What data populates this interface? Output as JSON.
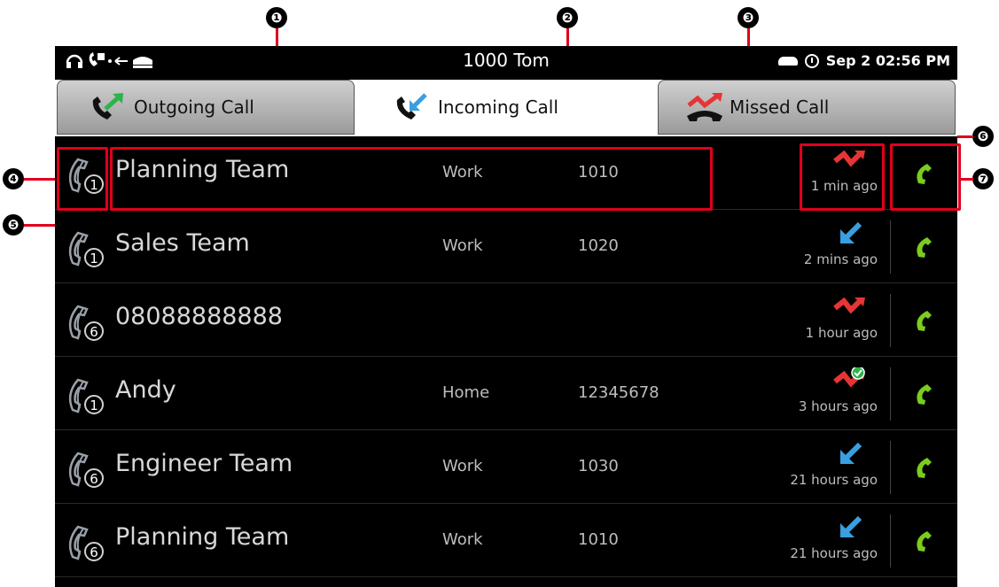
{
  "statusbar": {
    "left_icons": "headset, phone, arrows, handset",
    "title": "1000  Tom",
    "datetime": "Sep 2 02:56 PM"
  },
  "tabs": [
    {
      "label": "Outgoing Call",
      "icon": "outgoing-call-icon",
      "active": false
    },
    {
      "label": "Incoming Call",
      "icon": "incoming-call-icon",
      "active": true
    },
    {
      "label": "Missed Call",
      "icon": "missed-call-icon",
      "active": false
    }
  ],
  "calls": [
    {
      "count": "1",
      "name": "Planning Team",
      "phone_type": "Work",
      "number": "1010",
      "status": "missed",
      "time": "1 min ago"
    },
    {
      "count": "1",
      "name": "Sales Team",
      "phone_type": "Work",
      "number": "1020",
      "status": "incoming",
      "time": "2 mins ago"
    },
    {
      "count": "6",
      "name": "08088888888",
      "phone_type": "",
      "number": "",
      "status": "missed",
      "time": "1 hour ago"
    },
    {
      "count": "1",
      "name": "Andy",
      "phone_type": "Home",
      "number": "12345678",
      "status": "missed-checked",
      "time": "3 hours ago"
    },
    {
      "count": "6",
      "name": "Engineer Team",
      "phone_type": "Work",
      "number": "1030",
      "status": "incoming",
      "time": "21 hours ago"
    },
    {
      "count": "6",
      "name": "Planning Team",
      "phone_type": "Work",
      "number": "1010",
      "status": "incoming",
      "time": "21 hours ago"
    }
  ],
  "callouts": [
    "❶",
    "❷",
    "❸",
    "❹",
    "❺",
    "❻",
    "❼"
  ],
  "colors": {
    "annotation": "#e0001b",
    "incoming": "#3a9fe0",
    "missed": "#e53535",
    "outgoing": "#2db34a",
    "call_button": "#7acc1e"
  }
}
